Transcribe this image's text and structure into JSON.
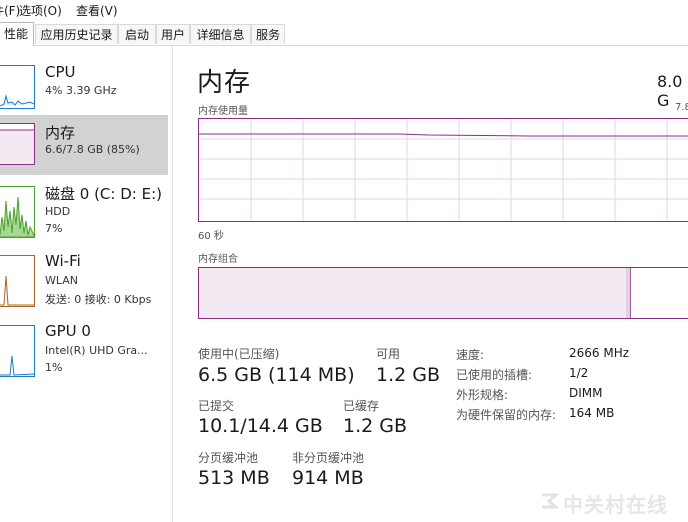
{
  "menu": {
    "items": [
      "件(F)",
      "选项(O)",
      "查看(V)"
    ]
  },
  "tabs": [
    "性能",
    "应用历史记录",
    "启动",
    "用户",
    "详细信息",
    "服务"
  ],
  "sidebar": {
    "items": [
      {
        "title": "CPU",
        "lines": [
          "4% 3.39 GHz"
        ],
        "color": "#1e7bc4"
      },
      {
        "title": "内存",
        "lines": [
          "6.6/7.8 GB (85%)"
        ],
        "color": "#8b2e8b"
      },
      {
        "title": "磁盘 0 (C: D: E:)",
        "lines": [
          "HDD",
          "7%"
        ],
        "color": "#4aa22b"
      },
      {
        "title": "Wi-Fi",
        "lines": [
          "WLAN",
          "发送: 0 接收: 0 Kbps"
        ],
        "color": "#a7651d"
      },
      {
        "title": "GPU 0",
        "lines": [
          "Intel(R) UHD Gra...",
          "1%"
        ],
        "color": "#1e7bc4"
      }
    ]
  },
  "main": {
    "title": "内存",
    "total": "8.0 G",
    "usage_label": "内存使用量",
    "usage_max": "7.8",
    "time_label": "60 秒",
    "composition_label": "内存组合",
    "accent_color": "#8b2e8b"
  },
  "stats": {
    "in_use_label": "使用中(已压缩)",
    "in_use_value": "6.5 GB (114 MB)",
    "available_label": "可用",
    "available_value": "1.2 GB",
    "committed_label": "已提交",
    "committed_value": "10.1/14.4 GB",
    "cached_label": "已缓存",
    "cached_value": "1.2 GB",
    "paged_label": "分页缓冲池",
    "paged_value": "513 MB",
    "nonpaged_label": "非分页缓冲池",
    "nonpaged_value": "914 MB"
  },
  "info": [
    {
      "label": "速度:",
      "value": "2666 MHz"
    },
    {
      "label": "已使用的插槽:",
      "value": "1/2"
    },
    {
      "label": "外形规格:",
      "value": "DIMM"
    },
    {
      "label": "为硬件保留的内存:",
      "value": "164 MB"
    }
  ],
  "watermark": "中关村在线"
}
